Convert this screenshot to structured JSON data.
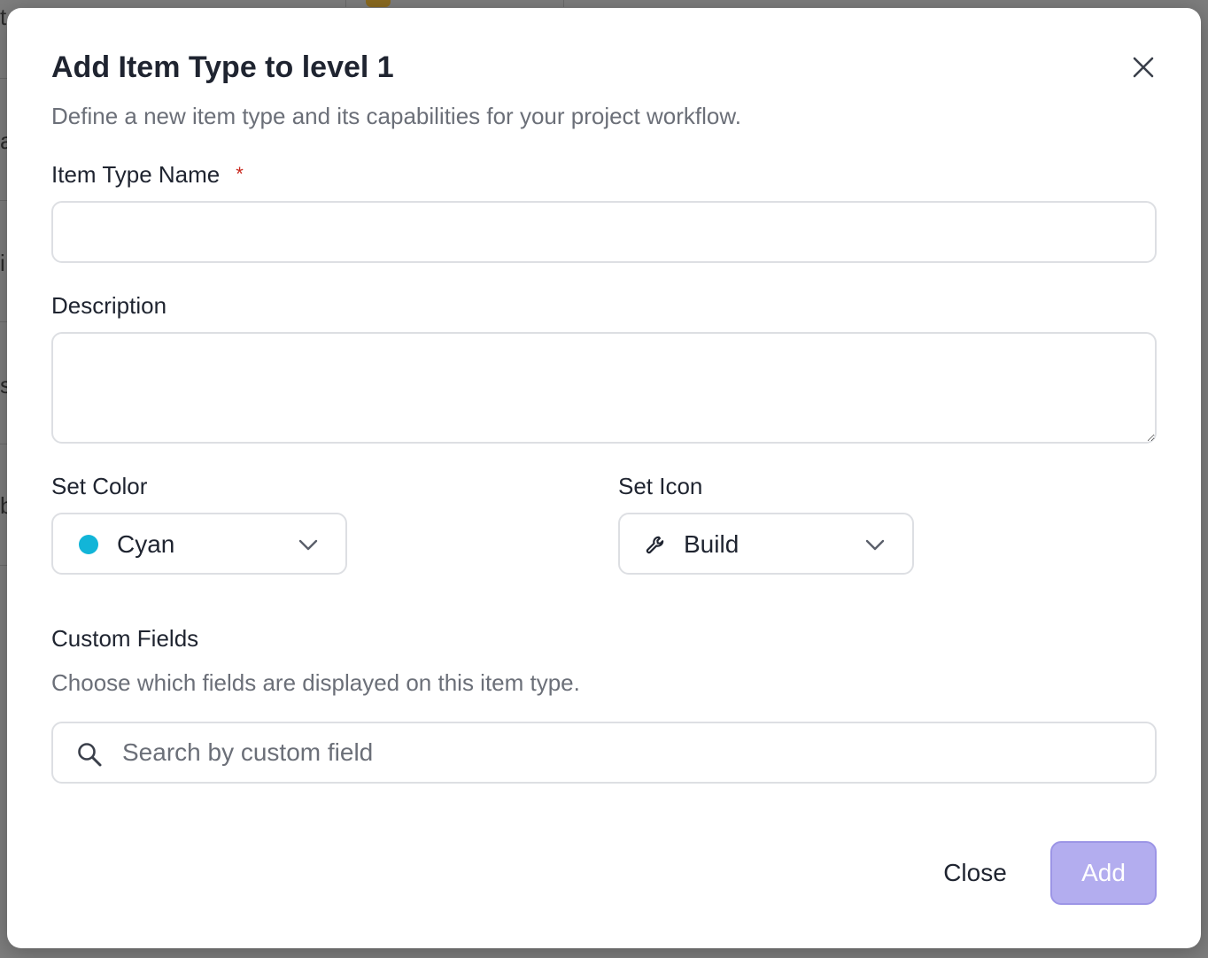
{
  "background": {
    "edge_letters": [
      "t",
      "a",
      "i",
      "s",
      "b"
    ]
  },
  "modal": {
    "title": "Add Item Type to level 1",
    "subtitle": "Define a new item type and its capabilities for your project workflow.",
    "close_icon": "close-icon"
  },
  "form": {
    "name_label": "Item Type Name",
    "required_marker": "*",
    "name_value": "",
    "description_label": "Description",
    "description_value": "",
    "color_label": "Set Color",
    "color_value": "Cyan",
    "color_hex": "#12b5d8",
    "icon_label": "Set Icon",
    "icon_value": "Build",
    "icon_name": "wrench-icon"
  },
  "custom_fields": {
    "title": "Custom Fields",
    "subtitle": "Choose which fields are displayed on this item type.",
    "search_placeholder": "Search by custom field"
  },
  "footer": {
    "close_label": "Close",
    "add_label": "Add",
    "add_color": "#b3adef"
  }
}
